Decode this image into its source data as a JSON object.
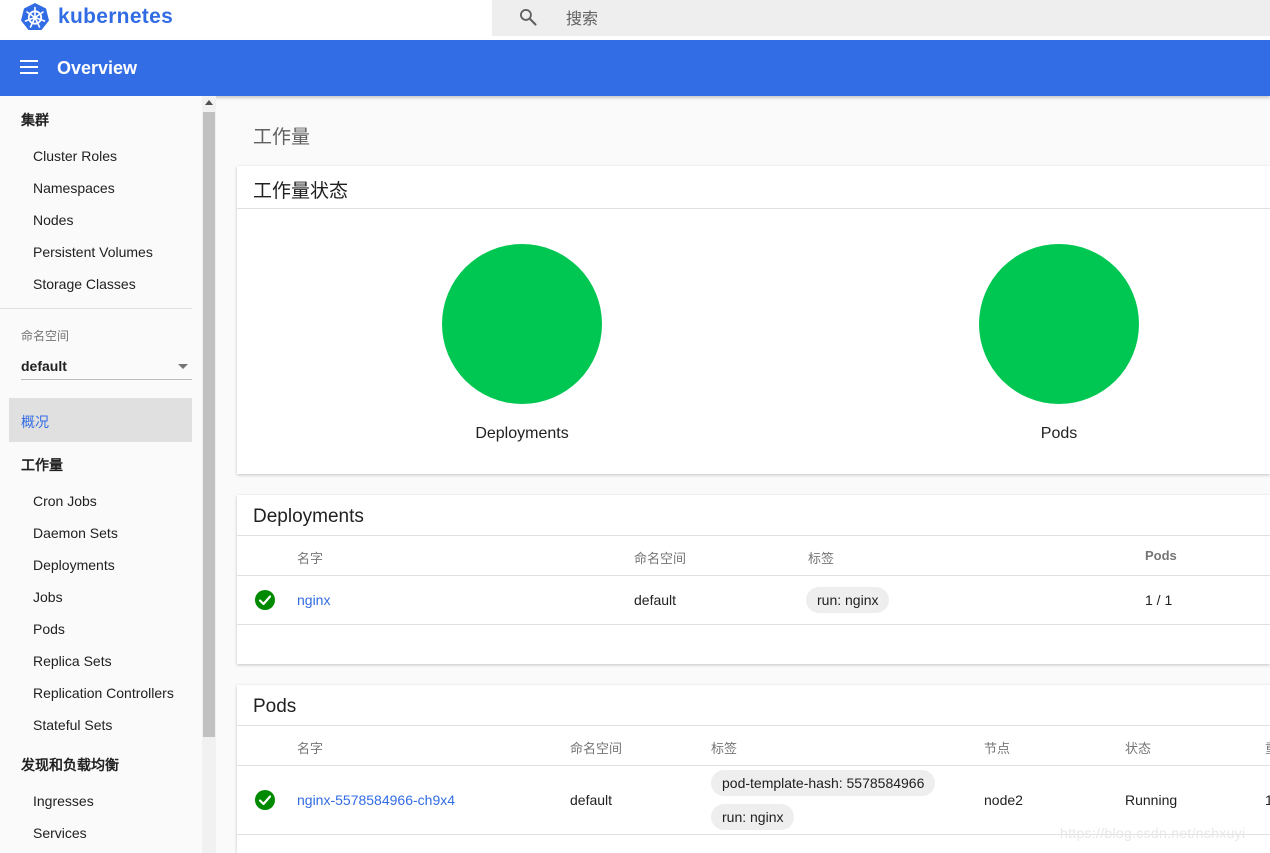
{
  "brand": {
    "name": "kubernetes"
  },
  "search": {
    "placeholder": "搜索"
  },
  "header": {
    "title": "Overview"
  },
  "sidebar": {
    "cluster": {
      "title": "集群",
      "items": [
        "Cluster Roles",
        "Namespaces",
        "Nodes",
        "Persistent Volumes",
        "Storage Classes"
      ]
    },
    "namespace": {
      "label": "命名空间",
      "value": "default"
    },
    "overview": {
      "label": "概况"
    },
    "workloads": {
      "title": "工作量",
      "items": [
        "Cron Jobs",
        "Daemon Sets",
        "Deployments",
        "Jobs",
        "Pods",
        "Replica Sets",
        "Replication Controllers",
        "Stateful Sets"
      ]
    },
    "discovery": {
      "title": "发现和负载均衡",
      "items": [
        "Ingresses",
        "Services"
      ]
    }
  },
  "main": {
    "heading": "工作量",
    "status_card": {
      "title": "工作量状态",
      "charts": [
        {
          "label": "Deployments",
          "status": "running",
          "value_percent": 100,
          "color": "#00c752"
        },
        {
          "label": "Pods",
          "status": "running",
          "value_percent": 100,
          "color": "#00c752"
        }
      ]
    },
    "deployments": {
      "title": "Deployments",
      "columns": [
        "名字",
        "命名空间",
        "标签",
        "Pods"
      ],
      "rows": [
        {
          "name": "nginx",
          "namespace": "default",
          "labels": [
            "run: nginx"
          ],
          "pods": "1 / 1"
        }
      ]
    },
    "pods": {
      "title": "Pods",
      "columns": [
        "名字",
        "命名空间",
        "标签",
        "节点",
        "状态",
        "重"
      ],
      "rows": [
        {
          "name": "nginx-5578584966-ch9x4",
          "namespace": "default",
          "labels": [
            "pod-template-hash: 5578584966",
            "run: nginx"
          ],
          "node": "node2",
          "status": "Running",
          "restarts": "1"
        }
      ]
    }
  },
  "watermark": "https://blog.csdn.net/nshxuyi",
  "colors": {
    "accent": "#326de6",
    "success": "#00c752",
    "success_icon": "#008a00"
  }
}
